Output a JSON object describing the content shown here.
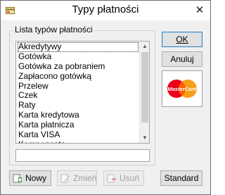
{
  "window": {
    "title": "Typy płatności"
  },
  "group": {
    "title": "Lista typów płatności",
    "items": [
      "Akredytywy",
      "Gotówka",
      "Gotówka za pobraniem",
      "Zapłacono gotówką",
      "Przelew",
      "Czek",
      "Raty",
      "Karta kredytowa",
      "Karta płatnicza",
      "Karta VISA",
      "Kompensata"
    ],
    "selected_index": 0,
    "input_value": ""
  },
  "buttons": {
    "ok": "OK",
    "anuluj": "Anuluj",
    "nowy": "Nowy",
    "zmien": "Zmień",
    "usun": "Usuń",
    "standard": "Standard"
  },
  "mastercard": {
    "logo_text": "MasterCard",
    "colors": {
      "red": "#eb001b",
      "orange": "#f79e1b"
    }
  },
  "icons": {
    "app": "payment-icon",
    "close": "close-icon",
    "nowy": "add-icon",
    "zmien": "edit-icon",
    "usun": "delete-icon"
  }
}
